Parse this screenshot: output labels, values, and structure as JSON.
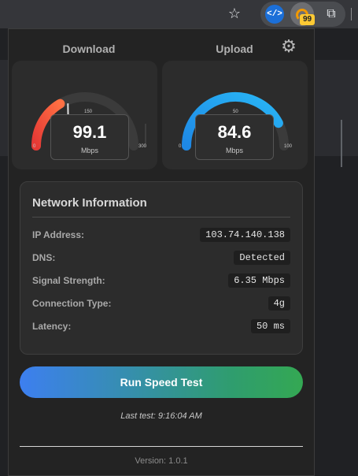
{
  "browser": {
    "star_icon": "star-icon",
    "extensions": [
      {
        "name": "dev-tools-extension-icon",
        "glyph": "</>"
      },
      {
        "name": "speed-test-extension-icon",
        "badge": "99"
      },
      {
        "name": "puzzle-icon",
        "glyph": "extensions"
      }
    ]
  },
  "header": {
    "download_label": "Download",
    "upload_label": "Upload",
    "settings_icon": "gear-icon"
  },
  "gauges": {
    "download": {
      "value": "99.1",
      "unit": "Mbps",
      "min_label": "0",
      "mid_label": "150",
      "max_label": "300",
      "fraction": 0.33,
      "color_start": "#e53935",
      "color_end": "#ff7043"
    },
    "upload": {
      "value": "84.6",
      "unit": "Mbps",
      "min_label": "0",
      "mid_label": "50",
      "max_label": "100",
      "fraction": 0.846,
      "color_start": "#1e88e5",
      "color_end": "#29b6f6"
    }
  },
  "network": {
    "title": "Network Information",
    "rows": [
      {
        "label": "IP Address:",
        "value": "103.74.140.138"
      },
      {
        "label": "DNS:",
        "value": "Detected"
      },
      {
        "label": "Signal Strength:",
        "value": "6.35 Mbps"
      },
      {
        "label": "Connection Type:",
        "value": "4g"
      },
      {
        "label": "Latency:",
        "value": "50 ms"
      }
    ]
  },
  "actions": {
    "run_label": "Run Speed Test",
    "last_test": "Last test: 9:16:04 AM"
  },
  "footer": {
    "version": "Version: 1.0.1"
  },
  "colors": {
    "accent_blue": "#3d7ff0",
    "accent_green": "#34a853"
  }
}
